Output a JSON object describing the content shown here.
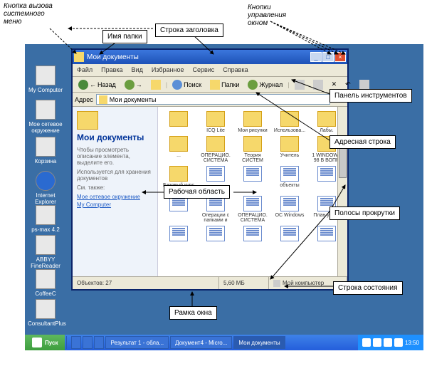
{
  "annotations": {
    "sysmenu": "Кнопка вызова системного меню",
    "foldername": "Имя папки",
    "titlebar": "Строка заголовка",
    "winbuttons": "Кнопки управления окном",
    "toolbar": "Панель инструментов",
    "addrbar": "Адресная строка",
    "workarea": "Рабочая область",
    "scrollbars": "Полосы прокрутки",
    "statusbar": "Строка состояния",
    "frame": "Рамка окна"
  },
  "desktop_icons": [
    {
      "label": "My Computer"
    },
    {
      "label": "Мое сетевое окружение"
    },
    {
      "label": "Корзина"
    },
    {
      "label": "Internet Explorer"
    },
    {
      "label": "ps-max 4.2"
    },
    {
      "label": "ABBYY FineReader"
    },
    {
      "label": "CoffeeC"
    },
    {
      "label": "ConsultantPlus"
    }
  ],
  "window": {
    "title": "Мои документы",
    "menu": [
      "Файл",
      "Правка",
      "Вид",
      "Избранное",
      "Сервис",
      "Справка"
    ],
    "toolbar": {
      "back": "Назад",
      "fwd": "",
      "up": "",
      "search": "Поиск",
      "folders": "Папки",
      "history": "Журнал"
    },
    "address": {
      "label": "Адрес",
      "value": "Мои документы"
    },
    "sidepane": {
      "title": "Мои документы",
      "hint1": "Чтобы просмотреть описание элемента, выделите его.",
      "hint2": "Используется для хранения документов",
      "see": "См. также:",
      "link1": "Мое сетевое окружение",
      "link2": "My Computer"
    },
    "items": [
      {
        "t": "f",
        "l": ""
      },
      {
        "t": "f",
        "l": "ICQ Lite"
      },
      {
        "t": "f",
        "l": "Мои рисунки"
      },
      {
        "t": "f",
        "l": "Использова..."
      },
      {
        "t": "f",
        "l": "Лабы."
      },
      {
        "t": "f",
        "l": "..."
      },
      {
        "t": "f",
        "l": "ОПЕРАЦИО. СИСТЕМА"
      },
      {
        "t": "f",
        "l": "Теория СИСТЕМ"
      },
      {
        "t": "f",
        "l": "Учитель"
      },
      {
        "t": "f",
        "l": "1 WINDOWS 98 В ВОПР."
      },
      {
        "t": "f",
        "l": "Базовый курс ПК Часть 1"
      },
      {
        "t": "d",
        "l": ""
      },
      {
        "t": "d",
        "l": ""
      },
      {
        "t": "d",
        "l": "объекты"
      },
      {
        "t": "d",
        "l": ""
      },
      {
        "t": "d",
        "l": ""
      },
      {
        "t": "d",
        "l": "Операции с папками и"
      },
      {
        "t": "d",
        "l": "ОПЕРАЦИО. СИСТЕМА"
      },
      {
        "t": "d",
        "l": "ОС Windows"
      },
      {
        "t": "d",
        "l": "План урока"
      },
      {
        "t": "d",
        "l": ""
      },
      {
        "t": "d",
        "l": ""
      },
      {
        "t": "d",
        "l": ""
      },
      {
        "t": "d",
        "l": ""
      },
      {
        "t": "d",
        "l": ""
      }
    ],
    "status": {
      "count": "Объектов: 27",
      "size": "5,60 МБ",
      "loc": "Мой компьютер"
    }
  },
  "taskbar": {
    "start": "Пуск",
    "items": [
      "",
      "Результат 1 - обла...",
      "Документ4 - Micro...",
      "Мои документы"
    ],
    "clock": "13:50"
  }
}
